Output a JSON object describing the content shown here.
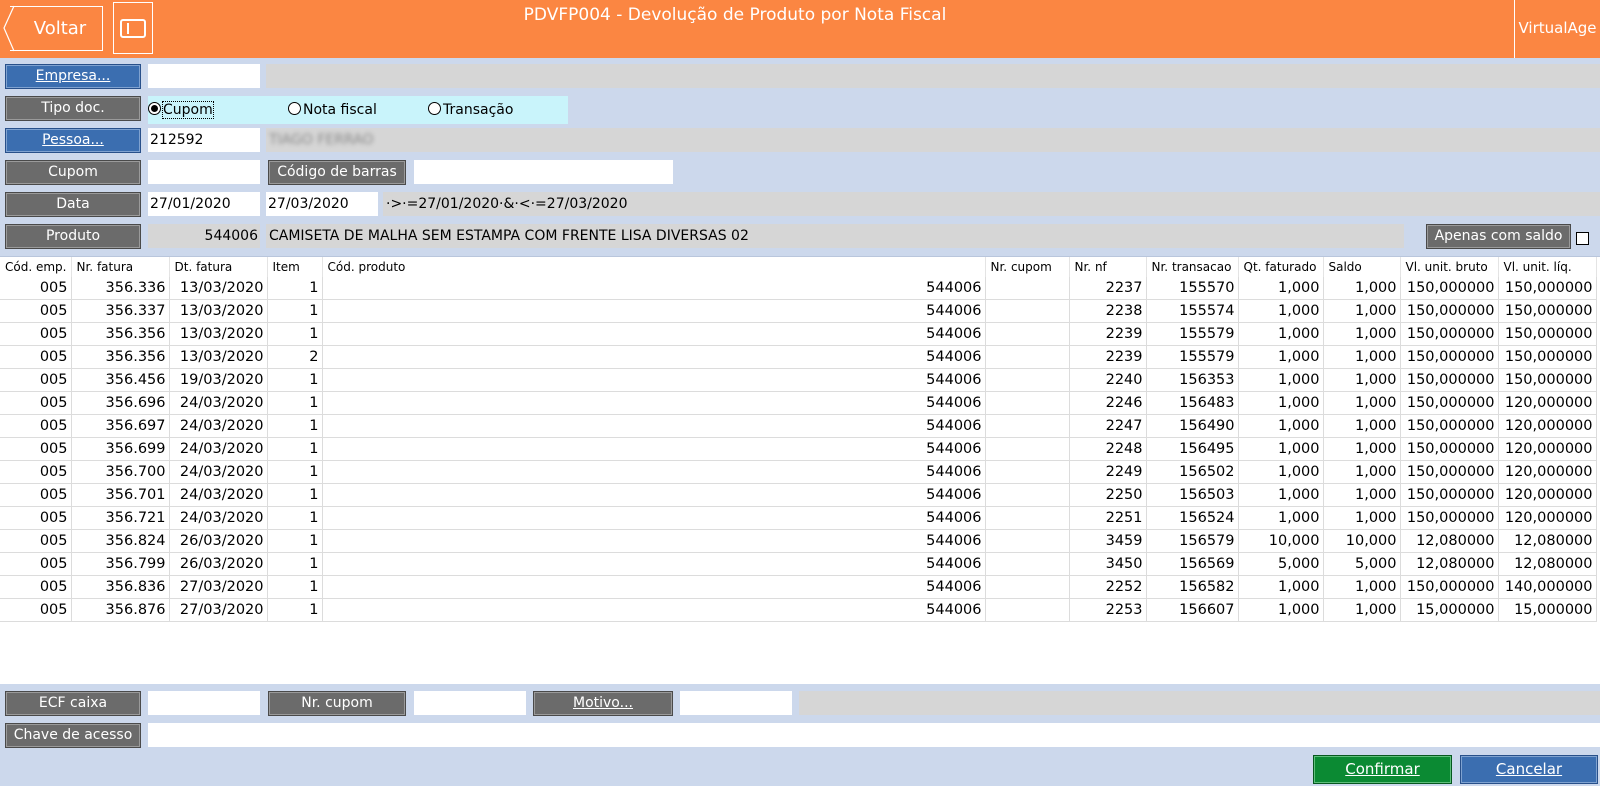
{
  "header": {
    "back_label": "Voltar",
    "title": "PDVFP004 - Devolução de Produto por Nota Fiscal",
    "brand": "VirtualAge",
    "color": "#fb8642"
  },
  "form": {
    "empresa_label": "Empresa...",
    "tipo_doc_label": "Tipo doc.",
    "tipo_options": [
      "Cupom",
      "Nota fiscal",
      "Transação"
    ],
    "tipo_selected": "Cupom",
    "pessoa_label": "Pessoa...",
    "pessoa_code": "212592",
    "pessoa_name": "TIAGO FERRAO",
    "cupom_label": "Cupom",
    "barcode_label": "Código de barras",
    "data_label": "Data",
    "data_from": "27/01/2020",
    "data_to": "27/03/2020",
    "data_filter": "·>·=27/01/2020·&·<·=27/03/2020",
    "produto_label": "Produto",
    "produto_code": "544006",
    "produto_desc": "CAMISETA DE MALHA SEM ESTAMPA COM FRENTE LISA DIVERSAS 02",
    "apenas_label": "Apenas com saldo"
  },
  "table": {
    "columns": [
      "Cód. emp.",
      "Nr. fatura",
      "Dt. fatura",
      "Item",
      "Cód. produto",
      "Nr. cupom",
      "Nr. nf",
      "Nr. transacao",
      "Qt. faturado",
      "Saldo",
      "Vl. unit. bruto",
      "Vl. unit. líq."
    ],
    "rows": [
      [
        "005",
        "356.336",
        "13/03/2020",
        "1",
        "544006",
        "",
        "2237",
        "155570",
        "1,000",
        "1,000",
        "150,000000",
        "150,000000"
      ],
      [
        "005",
        "356.337",
        "13/03/2020",
        "1",
        "544006",
        "",
        "2238",
        "155574",
        "1,000",
        "1,000",
        "150,000000",
        "150,000000"
      ],
      [
        "005",
        "356.356",
        "13/03/2020",
        "1",
        "544006",
        "",
        "2239",
        "155579",
        "1,000",
        "1,000",
        "150,000000",
        "150,000000"
      ],
      [
        "005",
        "356.356",
        "13/03/2020",
        "2",
        "544006",
        "",
        "2239",
        "155579",
        "1,000",
        "1,000",
        "150,000000",
        "150,000000"
      ],
      [
        "005",
        "356.456",
        "19/03/2020",
        "1",
        "544006",
        "",
        "2240",
        "156353",
        "1,000",
        "1,000",
        "150,000000",
        "150,000000"
      ],
      [
        "005",
        "356.696",
        "24/03/2020",
        "1",
        "544006",
        "",
        "2246",
        "156483",
        "1,000",
        "1,000",
        "150,000000",
        "120,000000"
      ],
      [
        "005",
        "356.697",
        "24/03/2020",
        "1",
        "544006",
        "",
        "2247",
        "156490",
        "1,000",
        "1,000",
        "150,000000",
        "120,000000"
      ],
      [
        "005",
        "356.699",
        "24/03/2020",
        "1",
        "544006",
        "",
        "2248",
        "156495",
        "1,000",
        "1,000",
        "150,000000",
        "120,000000"
      ],
      [
        "005",
        "356.700",
        "24/03/2020",
        "1",
        "544006",
        "",
        "2249",
        "156502",
        "1,000",
        "1,000",
        "150,000000",
        "120,000000"
      ],
      [
        "005",
        "356.701",
        "24/03/2020",
        "1",
        "544006",
        "",
        "2250",
        "156503",
        "1,000",
        "1,000",
        "150,000000",
        "120,000000"
      ],
      [
        "005",
        "356.721",
        "24/03/2020",
        "1",
        "544006",
        "",
        "2251",
        "156524",
        "1,000",
        "1,000",
        "150,000000",
        "120,000000"
      ],
      [
        "005",
        "356.824",
        "26/03/2020",
        "1",
        "544006",
        "",
        "3459",
        "156579",
        "10,000",
        "10,000",
        "12,080000",
        "12,080000"
      ],
      [
        "005",
        "356.799",
        "26/03/2020",
        "1",
        "544006",
        "",
        "3450",
        "156569",
        "5,000",
        "5,000",
        "12,080000",
        "12,080000"
      ],
      [
        "005",
        "356.836",
        "27/03/2020",
        "1",
        "544006",
        "",
        "2252",
        "156582",
        "1,000",
        "1,000",
        "150,000000",
        "140,000000"
      ],
      [
        "005",
        "356.876",
        "27/03/2020",
        "1",
        "544006",
        "",
        "2253",
        "156607",
        "1,000",
        "1,000",
        "15,000000",
        "15,000000"
      ]
    ]
  },
  "footer": {
    "ecf_label": "ECF caixa",
    "nr_cupom_label": "Nr. cupom",
    "motivo_label": "Motivo...",
    "chave_label": "Chave de acesso",
    "confirm_label": "Confirmar",
    "cancel_label": "Cancelar"
  }
}
